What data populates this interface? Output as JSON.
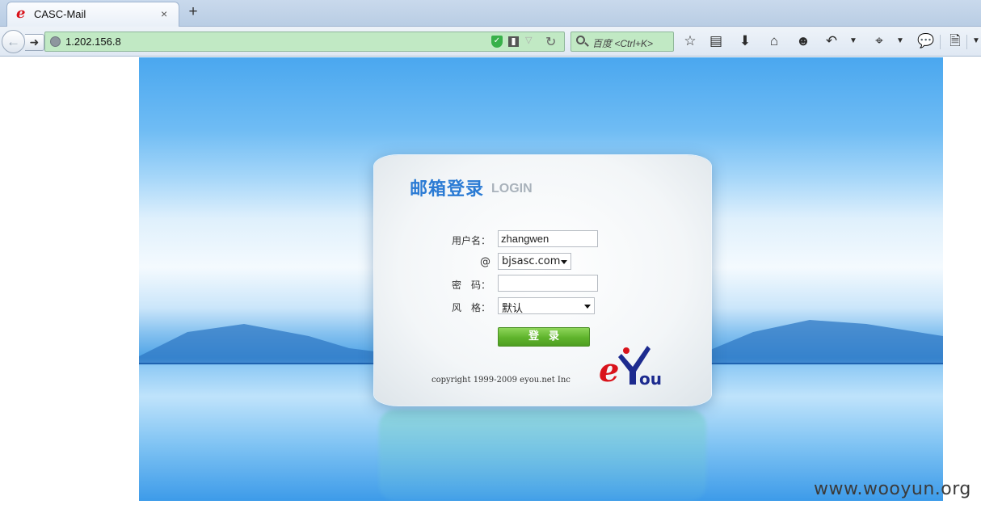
{
  "browser": {
    "tab": {
      "favicon": "e",
      "title": "CASC-Mail",
      "close_label": "×"
    },
    "new_tab_label": "+",
    "url": "1.202.156.8",
    "search_placeholder": "百度 <Ctrl+K>",
    "toolbar_icons": [
      "star-icon",
      "reading-list-icon",
      "download-icon",
      "home-icon",
      "smiley-icon",
      "undo-icon",
      "crop-icon",
      "chat-icon",
      "page-icon"
    ]
  },
  "login": {
    "title_cn": "邮箱登录",
    "title_en": "LOGIN",
    "username_label": "用户名：",
    "username_value": "zhangwen",
    "domain_label": "@",
    "domain_value": "bjsasc.com",
    "password_label": "密　码：",
    "password_value": "",
    "style_label": "风　格：",
    "style_value": "默认",
    "submit_label": "登录",
    "copyright": "copyright 1999-2009 eyou.net Inc",
    "logo_text": "eYou"
  },
  "watermark": "www.wooyun.org",
  "colors": {
    "title_blue": "#2b7bd4",
    "button_green": "#5fb32c",
    "url_bar_green": "#c1e9c4",
    "logo_red": "#d9131b",
    "logo_navy": "#1d2b8f"
  }
}
